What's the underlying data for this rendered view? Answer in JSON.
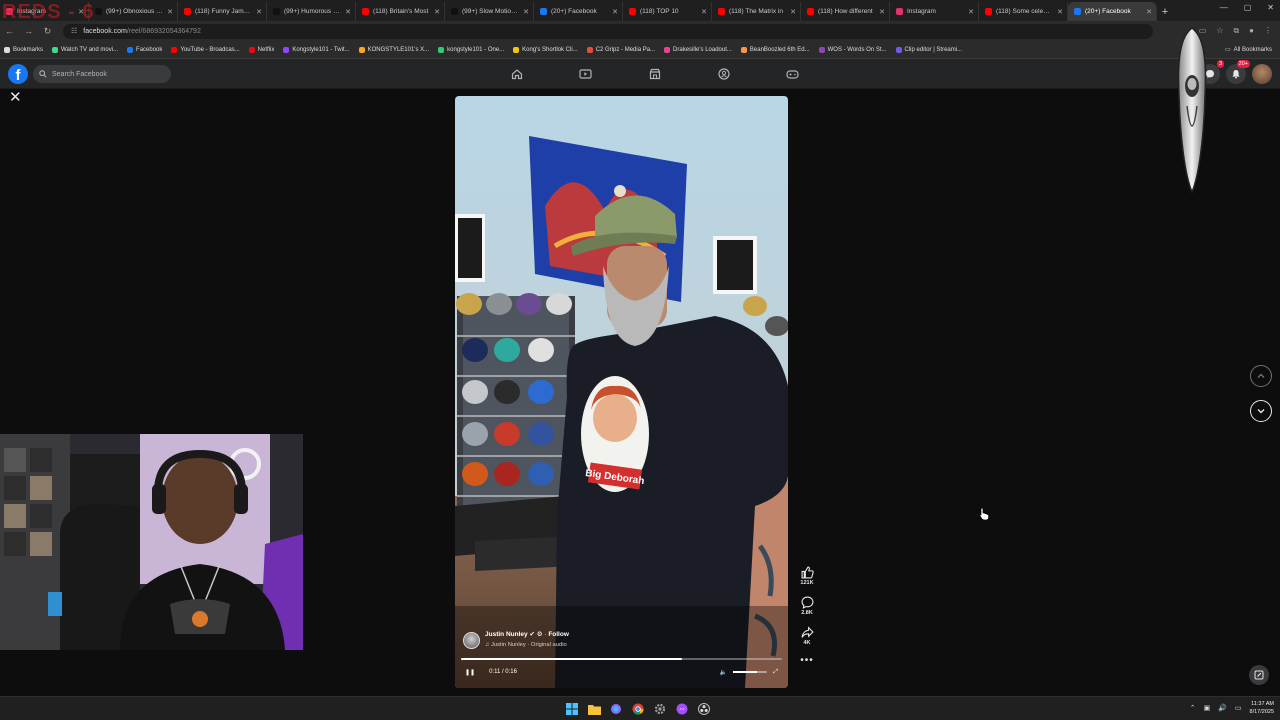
{
  "watermark": "REDS - 6",
  "browser": {
    "tabs": [
      {
        "title": "Instagram",
        "color": "#e1306c",
        "active": false
      },
      {
        "title": "(99+) Obnoxious Littl",
        "color": "#111111",
        "active": false
      },
      {
        "title": "(118) Funny James F",
        "color": "#ff0000",
        "active": false
      },
      {
        "title": "(99+) Humorous Bab",
        "color": "#111111",
        "active": false
      },
      {
        "title": "(118) Britain's Most",
        "color": "#ff0000",
        "active": false
      },
      {
        "title": "(99+) Slow Motion A",
        "color": "#111111",
        "active": false
      },
      {
        "title": "(20+) Facebook",
        "color": "#1877f2",
        "active": false
      },
      {
        "title": "(118) TOP 10",
        "color": "#ff0000",
        "active": false
      },
      {
        "title": "(118) The Matrix in",
        "color": "#ff0000",
        "active": false
      },
      {
        "title": "(118) How different",
        "color": "#ff0000",
        "active": false
      },
      {
        "title": "Instagram",
        "color": "#e1306c",
        "active": false
      },
      {
        "title": "(118) Some celebriti",
        "color": "#ff0000",
        "active": false
      },
      {
        "title": "(20+) Facebook",
        "color": "#1877f2",
        "active": true
      }
    ],
    "new_tab": "+",
    "url_host": "facebook.com",
    "url_path": "/reel/686932054364792",
    "bookmarks": [
      {
        "label": "Bookmarks",
        "color": "#dddddd"
      },
      {
        "label": "Watch TV and movi...",
        "color": "#3ddc84"
      },
      {
        "label": "Facebook",
        "color": "#1877f2"
      },
      {
        "label": "YouTube - Broadcas...",
        "color": "#ff0000"
      },
      {
        "label": "Netflix",
        "color": "#e50914"
      },
      {
        "label": "Kongstyle101 - Twit...",
        "color": "#9146ff"
      },
      {
        "label": "KONGSTYLE101's X...",
        "color": "#f5a623"
      },
      {
        "label": "kongstyle101 - One...",
        "color": "#2ecc71"
      },
      {
        "label": "Kong's Shortlok Cli...",
        "color": "#f1c40f"
      },
      {
        "label": "C2 Gripz - Media Pa...",
        "color": "#e74c3c"
      },
      {
        "label": "Drakesille's Loadout...",
        "color": "#e84393"
      },
      {
        "label": "BeanBoozled 6th Ed...",
        "color": "#fd9644"
      },
      {
        "label": "WOS - Words On St...",
        "color": "#8e44ad"
      },
      {
        "label": "Clip editor | Streami...",
        "color": "#6c5ce7"
      }
    ],
    "all_bookmarks": "All Bookmarks"
  },
  "facebook": {
    "search_placeholder": "Search Facebook",
    "notif_badge": "3",
    "messenger_badge": "20+"
  },
  "reel": {
    "creator_name": "Justin Nunley",
    "follow": "Follow",
    "audio": "Justin Nunley · Original audio",
    "time": "0:11 / 0:16",
    "progress": 0.69,
    "volume": 0.7,
    "shirt_text": "Big Deborah",
    "likes": "121K",
    "comments": "2.8K",
    "shares": "4K"
  },
  "taskbar": {
    "time": "11:37 AM",
    "date": "8/17/2025"
  }
}
